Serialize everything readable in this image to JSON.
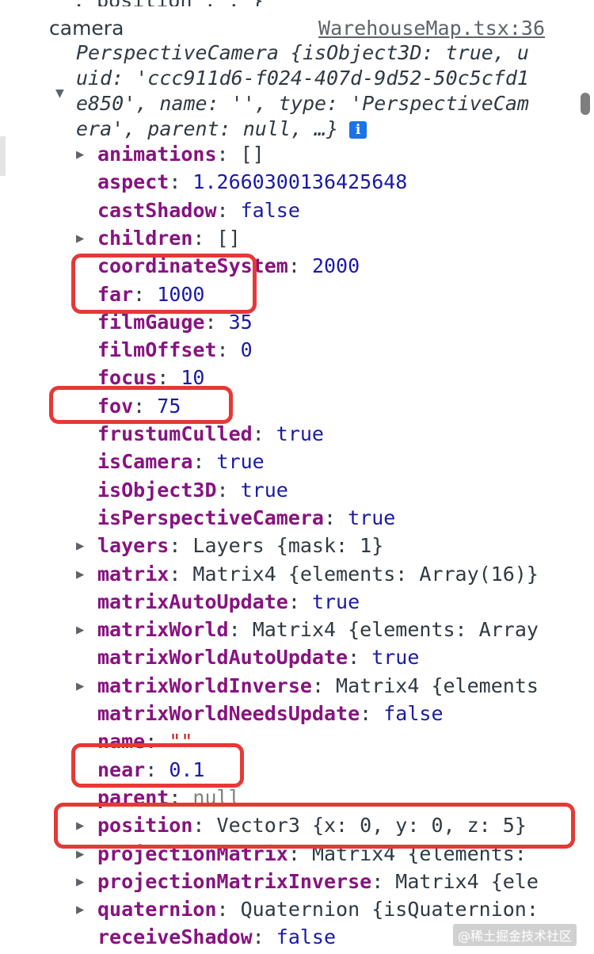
{
  "top_clipped": ", position , , }",
  "log_label": "camera",
  "source_link": "WarehouseMap.tsx:36",
  "summary": {
    "class_name": "PerspectiveCamera",
    "line1_rest": " {isObject3D: true, u",
    "line2": "uid: 'ccc911d6-f024-407d-9d52-50c5cfd1",
    "line3": "e850', name: '', type: 'PerspectiveCam",
    "line4": "era', parent: null, …}"
  },
  "properties": [
    {
      "key": "animations",
      "sep": ": ",
      "value": "[]",
      "type": "cls",
      "expandable": true
    },
    {
      "key": "aspect",
      "sep": ": ",
      "value": "1.2660300136425648",
      "type": "num",
      "expandable": false
    },
    {
      "key": "castShadow",
      "sep": ": ",
      "value": "false",
      "type": "bool",
      "expandable": false
    },
    {
      "key": "children",
      "sep": ": ",
      "value": "[]",
      "type": "cls",
      "expandable": true
    },
    {
      "key": "coordinateSystem",
      "sep": ": ",
      "value": "2000",
      "type": "num",
      "expandable": false
    },
    {
      "key": "far",
      "sep": ": ",
      "value": "1000",
      "type": "num",
      "expandable": false
    },
    {
      "key": "filmGauge",
      "sep": ": ",
      "value": "35",
      "type": "num",
      "expandable": false
    },
    {
      "key": "filmOffset",
      "sep": ": ",
      "value": "0",
      "type": "num",
      "expandable": false
    },
    {
      "key": "focus",
      "sep": ": ",
      "value": "10",
      "type": "num",
      "expandable": false
    },
    {
      "key": "fov",
      "sep": ": ",
      "value": "75",
      "type": "num",
      "expandable": false
    },
    {
      "key": "frustumCulled",
      "sep": ": ",
      "value": "true",
      "type": "bool",
      "expandable": false
    },
    {
      "key": "isCamera",
      "sep": ": ",
      "value": "true",
      "type": "bool",
      "expandable": false
    },
    {
      "key": "isObject3D",
      "sep": ": ",
      "value": "true",
      "type": "bool",
      "expandable": false
    },
    {
      "key": "isPerspectiveCamera",
      "sep": ": ",
      "value": "true",
      "type": "bool",
      "expandable": false
    },
    {
      "key": "layers",
      "sep": ": ",
      "value": "Layers {mask: 1}",
      "type": "cls",
      "expandable": true
    },
    {
      "key": "matrix",
      "sep": ": ",
      "value": "Matrix4 {elements: Array(16)}",
      "type": "cls",
      "expandable": true
    },
    {
      "key": "matrixAutoUpdate",
      "sep": ": ",
      "value": "true",
      "type": "bool",
      "expandable": false
    },
    {
      "key": "matrixWorld",
      "sep": ": ",
      "value": "Matrix4 {elements: Array",
      "type": "cls",
      "expandable": true
    },
    {
      "key": "matrixWorldAutoUpdate",
      "sep": ": ",
      "value": "true",
      "type": "bool",
      "expandable": false
    },
    {
      "key": "matrixWorldInverse",
      "sep": ": ",
      "value": "Matrix4 {elements",
      "type": "cls",
      "expandable": true
    },
    {
      "key": "matrixWorldNeedsUpdate",
      "sep": ": ",
      "value": "false",
      "type": "bool",
      "expandable": false
    },
    {
      "key": "name",
      "sep": ": ",
      "value": "\"\"",
      "type": "str",
      "expandable": false
    },
    {
      "key": "near",
      "sep": ": ",
      "value": "0.1",
      "type": "num",
      "expandable": false
    },
    {
      "key": "parent",
      "sep": ": ",
      "value": "null",
      "type": "nul",
      "expandable": false
    },
    {
      "key": "position",
      "sep": ": ",
      "value": "Vector3 {x: 0, y: 0, z: 5}",
      "type": "cls",
      "expandable": true
    },
    {
      "key": "projectionMatrix",
      "sep": ": ",
      "value": "Matrix4 {elements:",
      "type": "cls",
      "expandable": true
    },
    {
      "key": "projectionMatrixInverse",
      "sep": ": ",
      "value": "Matrix4 {ele",
      "type": "cls",
      "expandable": true
    },
    {
      "key": "quaternion",
      "sep": ": ",
      "value": "Quaternion {isQuaternion:",
      "type": "cls",
      "expandable": true
    },
    {
      "key": "receiveShadow",
      "sep": ": ",
      "value": "false",
      "type": "bool",
      "expandable": false
    }
  ],
  "highlighted_properties": [
    "coordinateSystem / far",
    "fov",
    "near",
    "position"
  ],
  "highlight_color": "#e53935",
  "watermark": "@稀土掘金技术社区",
  "icons": {
    "expander": "triangle-down-icon",
    "row_expander": "triangle-right-icon",
    "info": "info-icon"
  }
}
